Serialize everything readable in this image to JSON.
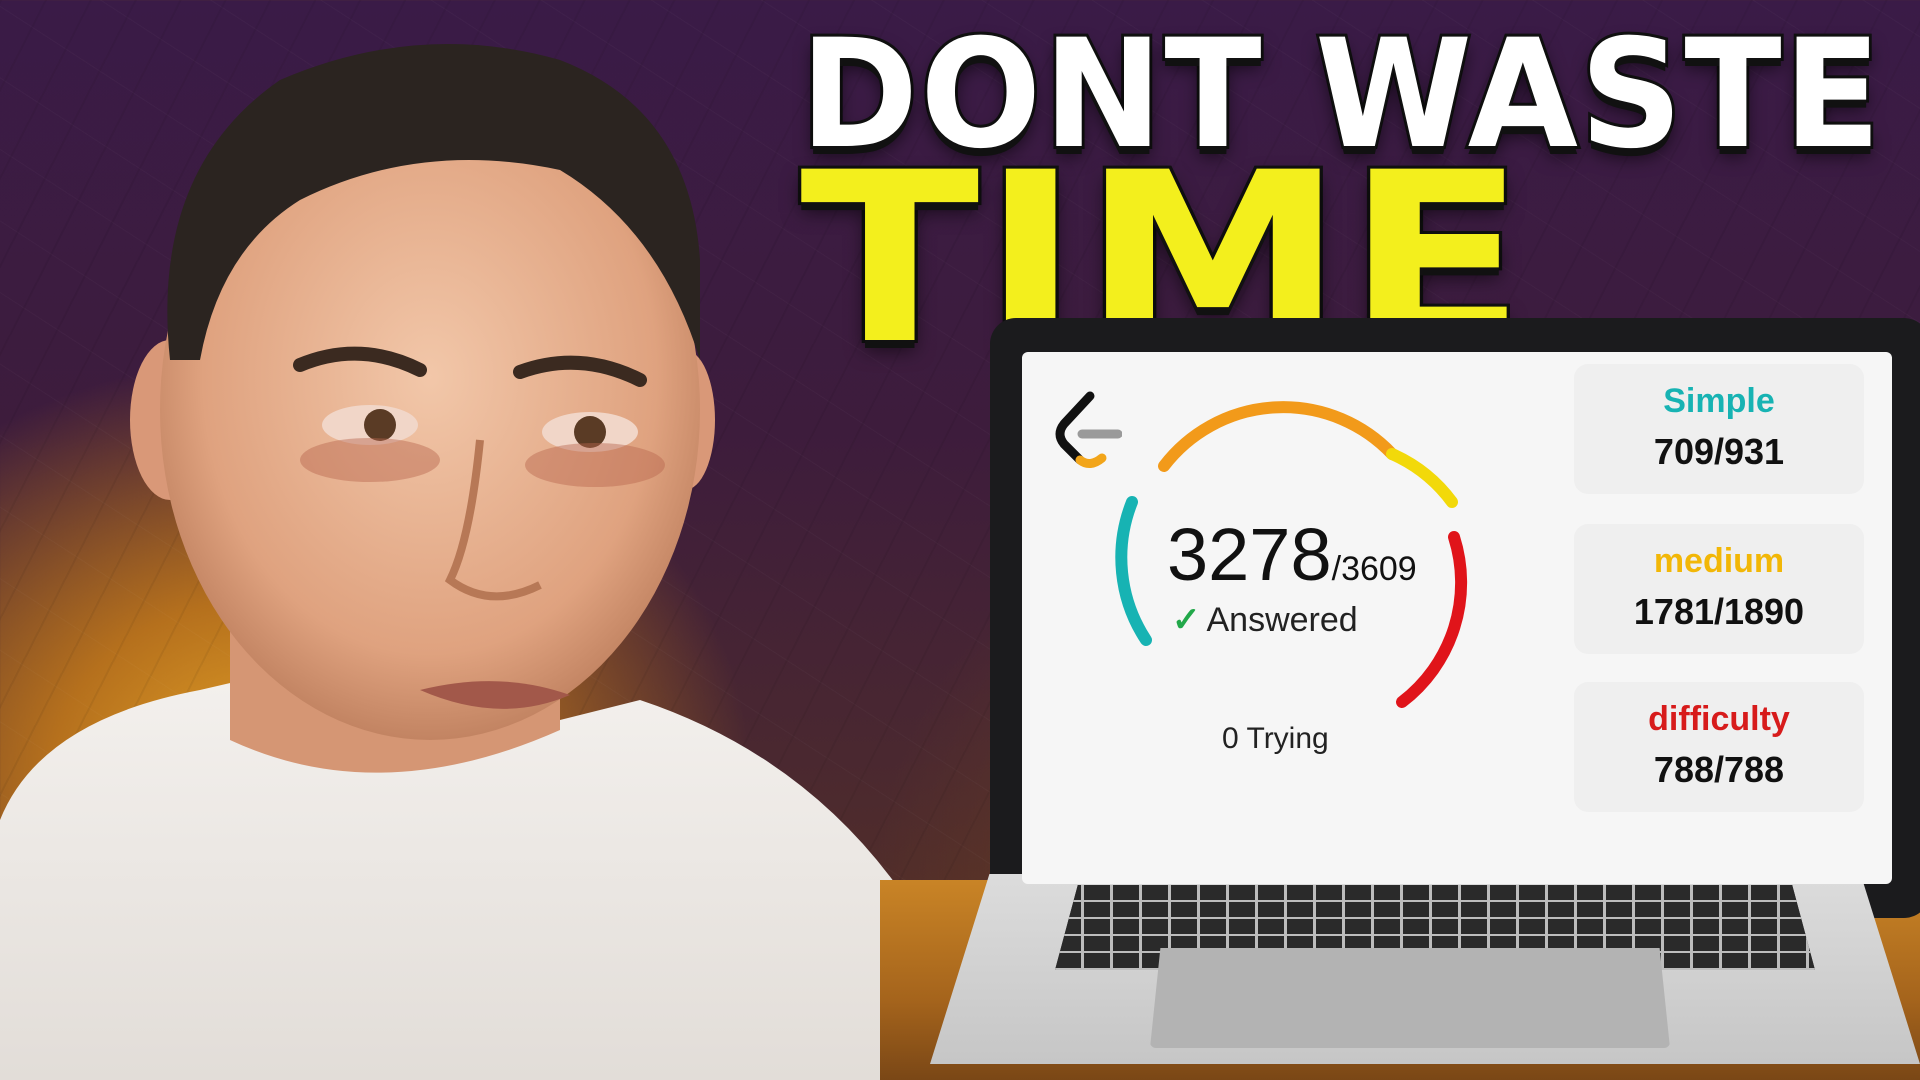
{
  "headline": {
    "line1": "DONT WASTE",
    "line2": "TIME"
  },
  "progress": {
    "solved": "3278",
    "total": "/3609",
    "status_label": "Answered",
    "attempting_label": "0 Trying",
    "fraction": 0.908
  },
  "stats": [
    {
      "label": "Simple",
      "value": "709/931",
      "color": "#17b3b3"
    },
    {
      "label": "medium",
      "value": "1781/1890",
      "color": "#f2b707"
    },
    {
      "label": "difficulty",
      "value": "788/788",
      "color": "#d71b1b"
    }
  ],
  "colors": {
    "headline_white": "#ffffff",
    "headline_yellow": "#f3ef1d",
    "gauge_teal": "#17b3b3",
    "gauge_orange": "#f29a1a",
    "gauge_yellow": "#f2d90a",
    "gauge_red": "#e0141a"
  },
  "icons": {
    "logo": "leetcode-logo-icon",
    "check": "check-icon"
  }
}
